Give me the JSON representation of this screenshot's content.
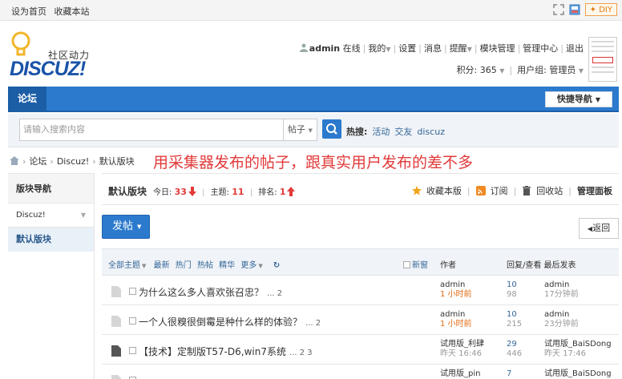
{
  "topbar": {
    "set_home": "设为首页",
    "bookmark": "收藏本站",
    "diy_label": "DIY"
  },
  "logo": {
    "cn": "社区动力",
    "en": "DISCUZ!"
  },
  "user": {
    "name": "admin",
    "status": "在线",
    "my": "我的",
    "settings": "设置",
    "messages": "消息",
    "remind": "提醒",
    "module_mgmt": "模块管理",
    "admin_center": "管理中心",
    "logout": "退出",
    "points": "积分: 365",
    "group": "用户组: 管理员"
  },
  "nav": {
    "forum": "论坛",
    "quick_nav": "快捷导航"
  },
  "search": {
    "placeholder": "请输入搜索内容",
    "type": "帖子",
    "hot_label": "热搜:",
    "hot_terms": [
      "活动",
      "交友",
      "discuz"
    ]
  },
  "breadcrumb": {
    "forum": "论坛",
    "discuz": "Discuz!",
    "board": "默认版块"
  },
  "annotation": "用采集器发布的帖子，跟真实用户发布的差不多",
  "sidebar": {
    "title": "版块导航",
    "category": "Discuz!",
    "item": "默认版块"
  },
  "board": {
    "title": "默认版块",
    "today_label": "今日:",
    "today": "33",
    "topics_label": "主题:",
    "topics": "11",
    "rank_label": "排名:",
    "rank": "1",
    "favorite": "收藏本版",
    "subscribe": "订阅",
    "recycle": "回收站",
    "admin_panel": "管理面板",
    "post_btn": "发帖",
    "back_btn": "返回"
  },
  "list": {
    "filters": [
      "全部主题",
      "最新",
      "热门",
      "热帖",
      "精华",
      "更多"
    ],
    "new_window": "新窗",
    "author_col": "作者",
    "stat_col": "回复/查看 最后发表",
    "rows": [
      {
        "title": "为什么这么多人喜欢张召忠？",
        "pages": "... 2",
        "author": "admin",
        "time": "1 小时前",
        "replies": "10",
        "views": "98",
        "last_user": "admin",
        "last_time": "17分钟前"
      },
      {
        "title": "一个人很糗很倒霉是种什么样的体验？",
        "pages": "... 2",
        "author": "admin",
        "time": "1 小时前",
        "replies": "10",
        "views": "215",
        "last_user": "admin",
        "last_time": "23分钟前"
      },
      {
        "title": "【技术】定制版T57-D6,win7系统",
        "pages": "... 2  3",
        "author": "试用版_利肆",
        "time": "昨天 16:46",
        "replies": "29",
        "views": "446",
        "last_user": "试用版_BaiSDong",
        "last_time": "昨天 17:46"
      },
      {
        "title": "",
        "pages": "",
        "author": "试用版_pin",
        "time": "",
        "replies": "7",
        "views": "",
        "last_user": "试用版_BaiSDong",
        "last_time": ""
      }
    ]
  }
}
